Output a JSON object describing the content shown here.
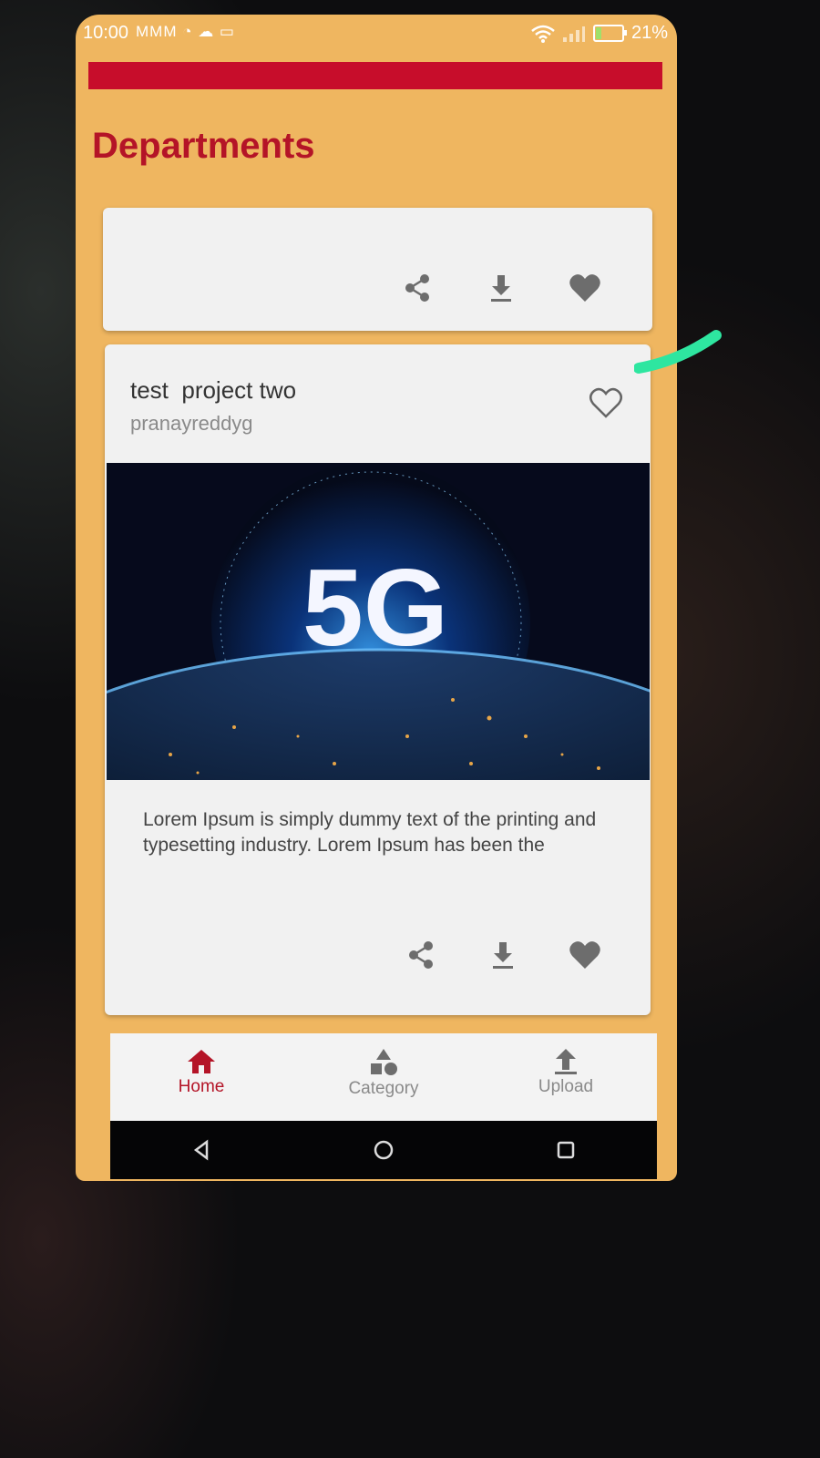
{
  "status_bar": {
    "time": "10:00",
    "notifications": "MMM ◔ ☁ ▭",
    "battery_percent": "21%",
    "battery_level": 0.21
  },
  "page": {
    "title": "Departments"
  },
  "cards": [
    {
      "actions": [
        "share-icon",
        "download-icon",
        "heart-icon"
      ]
    },
    {
      "title": "test  project two",
      "author": "pranayreddyg",
      "image_text": "5G",
      "description": "Lorem Ipsum is simply dummy text of the printing and typesetting industry. Lorem Ipsum has been the",
      "actions": [
        "share-icon",
        "download-icon",
        "heart-icon"
      ]
    }
  ],
  "bottom_nav": {
    "items": [
      {
        "label": "Home",
        "icon": "home-icon",
        "active": true
      },
      {
        "label": "Category",
        "icon": "category-icon",
        "active": false
      },
      {
        "label": "Upload",
        "icon": "upload-icon",
        "active": false
      }
    ]
  },
  "colors": {
    "background": "#efb660",
    "accent": "#b41427",
    "banner": "#c70d2b"
  }
}
